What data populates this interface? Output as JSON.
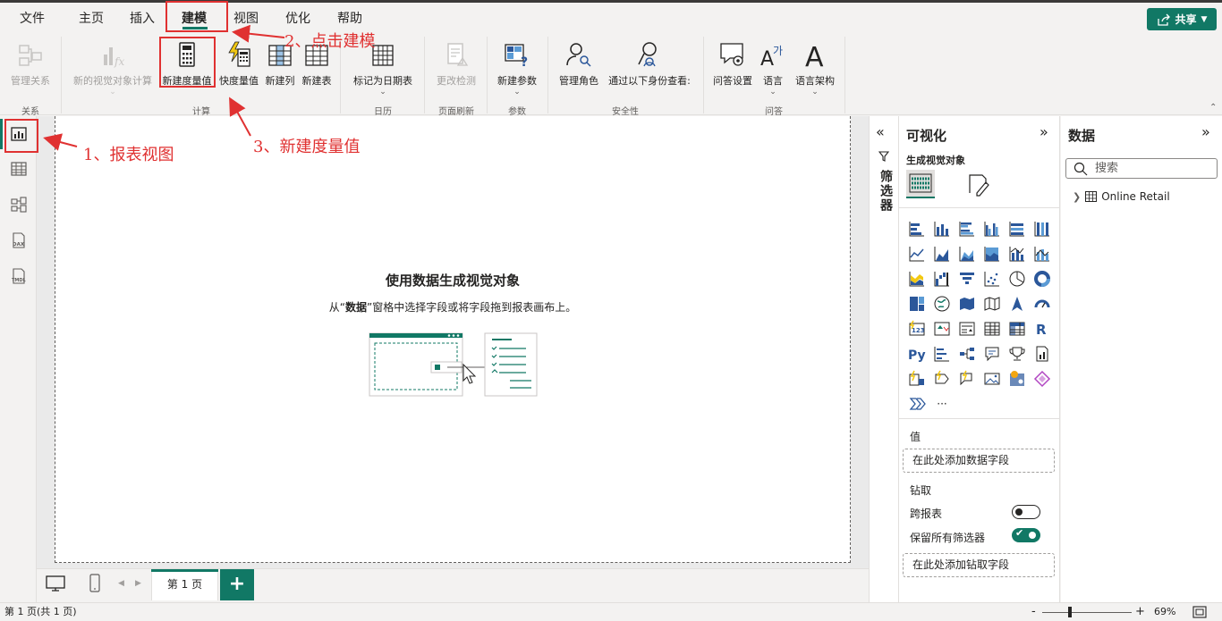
{
  "menu": {
    "tabs": [
      {
        "label": "文件"
      },
      {
        "label": "主页"
      },
      {
        "label": "插入"
      },
      {
        "label": "建模"
      },
      {
        "label": "视图"
      },
      {
        "label": "优化"
      },
      {
        "label": "帮助"
      }
    ],
    "share_label": "共享"
  },
  "ribbon": {
    "manage_relationships": "管理关系",
    "new_visual_calc": "新的视觉对象计算",
    "new_measure": "新建度量值",
    "quick_measure": "快度量值",
    "new_column": "新建列",
    "new_table": "新建表",
    "mark_date_table": "标记为日期表",
    "change_detection": "更改检测",
    "new_parameter": "新建参数",
    "manage_roles": "管理角色",
    "view_as": "通过以下身份查看:",
    "qa_setup": "问答设置",
    "language": "语言",
    "linguistic_schema": "语言架构",
    "groups": {
      "relationships": "关系",
      "calculations": "计算",
      "calendars": "日历",
      "page_refresh": "页面刷新",
      "parameters": "参数",
      "security": "安全性",
      "qa": "问答"
    }
  },
  "canvas": {
    "empty_title": "使用数据生成视觉对象",
    "empty_sub_prefix": "从“",
    "empty_sub_bold": "数据",
    "empty_sub_suffix": "”窗格中选择字段或将字段拖到报表画布上。"
  },
  "pages": {
    "tab_label": "第 1 页",
    "add_label": "+"
  },
  "status": {
    "page_info": "第 1 页(共 1 页)",
    "zoom": "69%",
    "zoom_minus": "-",
    "zoom_plus": "+"
  },
  "filters": {
    "label": "筛选器"
  },
  "visualizations": {
    "title": "可视化",
    "build_visual": "生成视觉对象",
    "values_label": "值",
    "values_placeholder": "在此处添加数据字段",
    "drill_label": "钻取",
    "cross_report": "跨报表",
    "keep_filters": "保留所有筛选器",
    "drill_placeholder": "在此处添加钻取字段",
    "cross_report_on": false,
    "keep_filters_on": true,
    "more_visuals": "···"
  },
  "data_pane": {
    "title": "数据",
    "search_placeholder": "搜索",
    "tables": [
      {
        "name": "Online Retail"
      }
    ]
  },
  "annotations": {
    "step1": "1、报表视图",
    "step2": "2、点击建模",
    "step3": "3、新建度量值"
  },
  "colors": {
    "accent": "#117865",
    "annotation": "#e03131"
  }
}
